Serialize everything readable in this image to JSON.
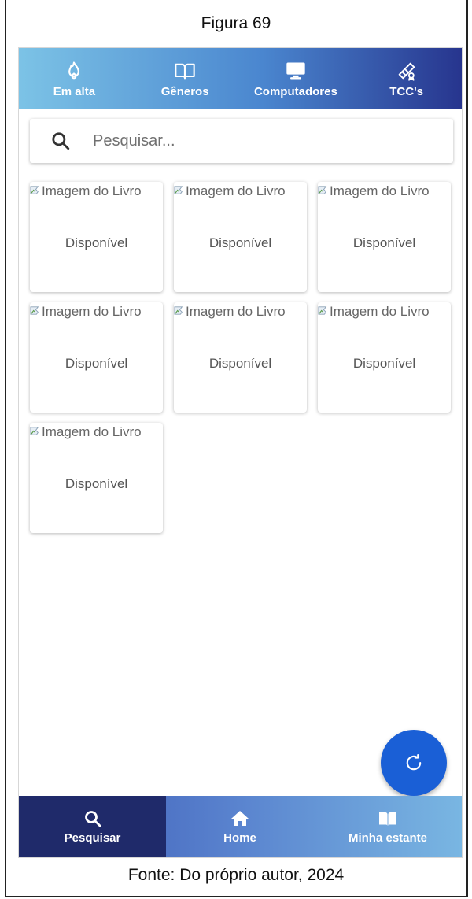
{
  "figure": {
    "title": "Figura 69",
    "caption": "Fonte: Do próprio autor, 2024"
  },
  "top_nav": {
    "items": [
      {
        "label": "Em alta",
        "icon": "fire-icon"
      },
      {
        "label": "Gêneros",
        "icon": "book-open-icon"
      },
      {
        "label": "Computadores",
        "icon": "monitor-icon"
      },
      {
        "label": "TCC's",
        "icon": "diploma-icon"
      }
    ]
  },
  "search": {
    "placeholder": "Pesquisar..."
  },
  "books": [
    {
      "image_alt": "Imagem do Livro",
      "status": "Disponível"
    },
    {
      "image_alt": "Imagem do Livro",
      "status": "Disponível"
    },
    {
      "image_alt": "Imagem do Livro",
      "status": "Disponível"
    },
    {
      "image_alt": "Imagem do Livro",
      "status": "Disponível"
    },
    {
      "image_alt": "Imagem do Livro",
      "status": "Disponível"
    },
    {
      "image_alt": "Imagem do Livro",
      "status": "Disponível"
    },
    {
      "image_alt": "Imagem do Livro",
      "status": "Disponível"
    }
  ],
  "fab": {
    "icon": "refresh-icon"
  },
  "bottom_nav": {
    "items": [
      {
        "label": "Pesquisar",
        "icon": "search-icon",
        "active": true
      },
      {
        "label": "Home",
        "icon": "home-icon",
        "active": false
      },
      {
        "label": "Minha estante",
        "icon": "book-icon",
        "active": false
      }
    ]
  },
  "colors": {
    "top_gradient": [
      "#7cc3e6",
      "#4a86cf",
      "#27358e"
    ],
    "bottom_gradient": [
      "#3a56b4",
      "#5a84cf",
      "#79b6e2"
    ],
    "active_tab": "#1f2a6a",
    "fab": "#1a5fd6"
  }
}
